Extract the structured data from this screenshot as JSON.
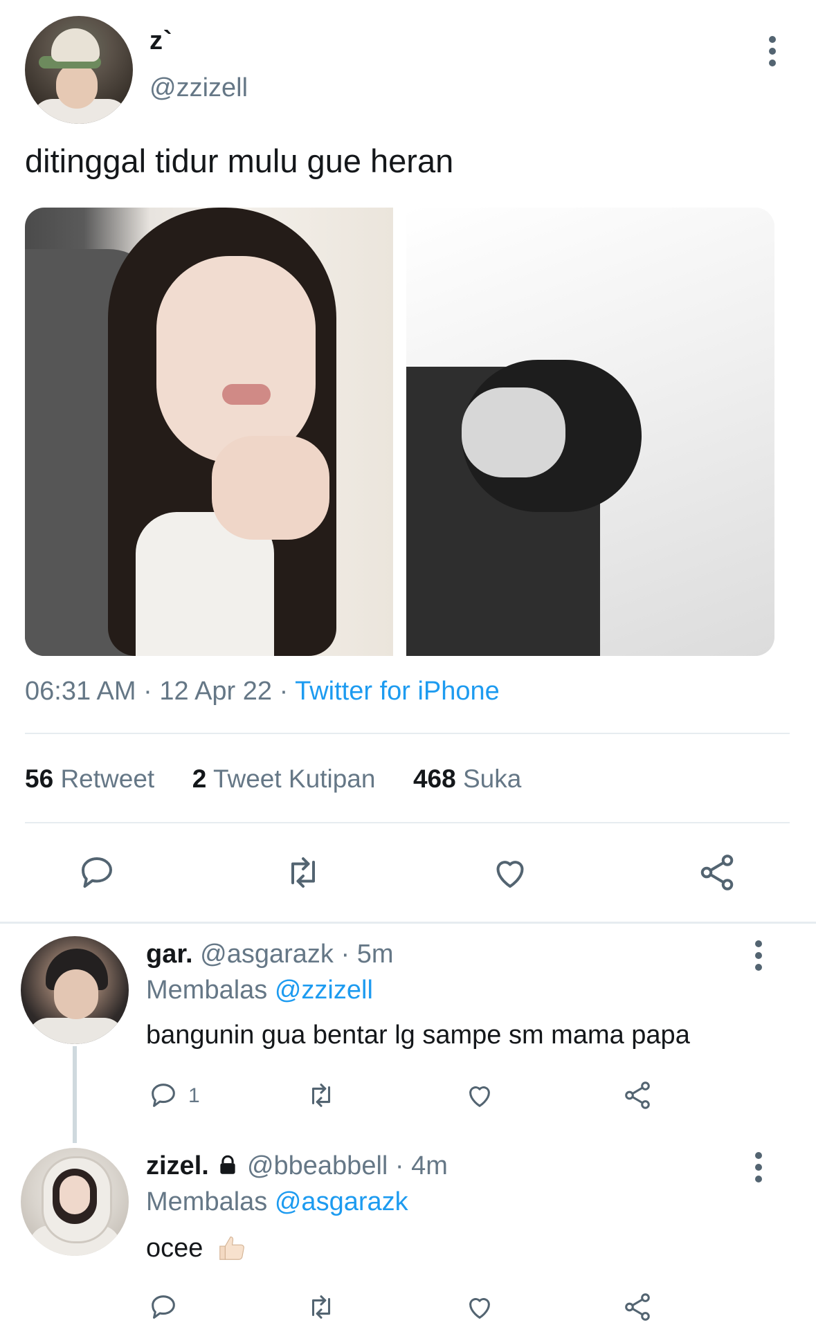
{
  "tweet": {
    "display_name": "z`",
    "handle": "@zzizell",
    "text": "ditinggal tidur mulu gue heran",
    "time": "06:31 AM",
    "date": "12 Apr 22",
    "separator": "·",
    "source": "Twitter for iPhone",
    "stats": {
      "retweets_count": "56",
      "retweets_label": "Retweet",
      "quotes_count": "2",
      "quotes_label": "Tweet Kutipan",
      "likes_count": "468",
      "likes_label": "Suka"
    }
  },
  "replies": [
    {
      "name": "gar.",
      "handle": "@asgarazk",
      "age": "5m",
      "replying_label": "Membalas",
      "replying_to": "@zzizell",
      "text": "bangunin gua bentar lg sampe sm mama papa",
      "reply_count": "1"
    },
    {
      "name": "zizel.",
      "handle": "@bbeabbell",
      "age": "4m",
      "replying_label": "Membalas",
      "replying_to": "@asgarazk",
      "text": "ocee",
      "locked": true
    }
  ],
  "icons": {
    "reply": "reply-icon",
    "retweet": "retweet-icon",
    "like": "heart-icon",
    "share": "share-icon",
    "more": "more-vertical-icon",
    "lock": "lock-icon",
    "thumbs_up": "thumbs-up-emoji"
  },
  "colors": {
    "accent": "#1d9bf0",
    "muted": "#657786",
    "icon": "#536471",
    "divider": "#e6ecf0"
  }
}
